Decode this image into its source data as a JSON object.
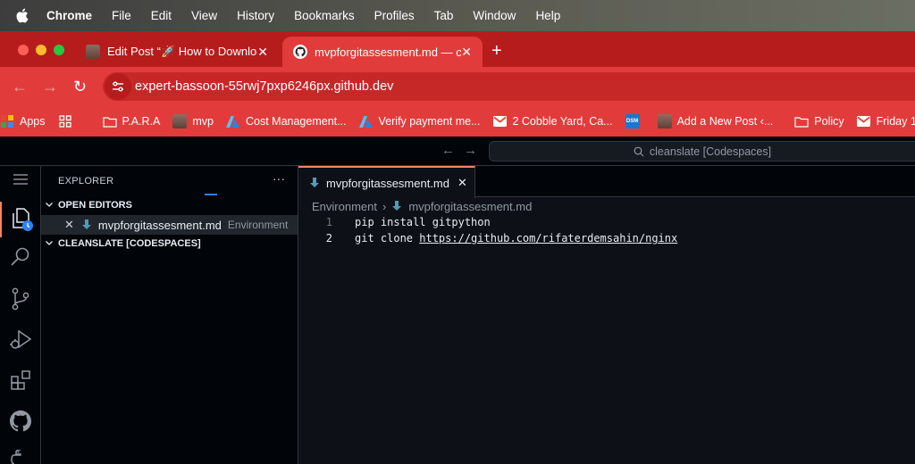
{
  "menubar": {
    "items": [
      "Chrome",
      "File",
      "Edit",
      "View",
      "History",
      "Bookmarks",
      "Profiles",
      "Tab",
      "Window",
      "Help"
    ]
  },
  "browser": {
    "tabs": [
      {
        "title": "Edit Post “🚀 How to Downloa",
        "icon": "avatar-icon",
        "active": false
      },
      {
        "title": "mvpforgitassesment.md — cle",
        "icon": "github-icon",
        "active": true
      }
    ],
    "address": "expert-bassoon-55rwj7pxp6246px.github.dev",
    "bookmarks": [
      {
        "label": "Apps",
        "icon": "apps-grid-icon"
      },
      {
        "label": "",
        "icon": "grid-icon"
      },
      {
        "label": "P.A.R.A",
        "icon": "folder-icon"
      },
      {
        "label": "mvp",
        "icon": "avatar-icon"
      },
      {
        "label": "Cost Management...",
        "icon": "azure-icon"
      },
      {
        "label": "Verify payment me...",
        "icon": "azure-icon"
      },
      {
        "label": "2 Cobble Yard, Ca...",
        "icon": "gmail-icon"
      },
      {
        "label": "",
        "icon": "dsm-icon"
      },
      {
        "label": "Add a New Post ‹...",
        "icon": "avatar-icon"
      },
      {
        "label": "Policy",
        "icon": "folder-icon"
      },
      {
        "label": "Friday 1",
        "icon": "gmail-icon"
      }
    ],
    "colors": {
      "frame": "#b71c1c",
      "toolbar": "#e23b3b"
    }
  },
  "codespace": {
    "command_center": "cleanslate [Codespaces]",
    "explorer": {
      "header": "EXPLORER",
      "open_editors_label": "OPEN EDITORS",
      "open_file": {
        "name": "mvpforgitassesment.md",
        "description": "Environment"
      },
      "workspace_label": "CLEANSLATE [CODESPACES]"
    },
    "editor": {
      "tab": "mvpforgitassesment.md",
      "breadcrumb": [
        "Environment",
        "mvpforgitassesment.md"
      ],
      "lines": [
        {
          "num": "1",
          "text": "pip install gitpython"
        },
        {
          "num": "2",
          "prefix": "git clone ",
          "url": "https://github.com/rifaterdemsahin/nginx"
        }
      ]
    }
  }
}
